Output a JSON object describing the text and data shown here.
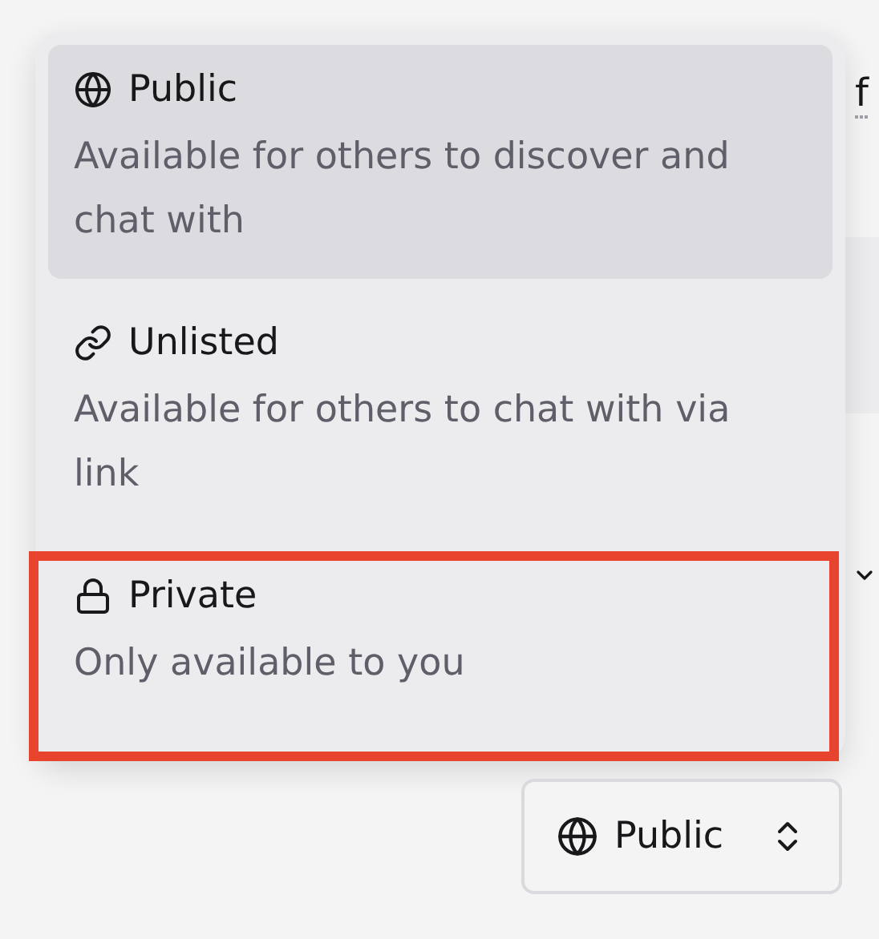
{
  "background": {
    "link_text": "f"
  },
  "visibility_menu": {
    "options": [
      {
        "kind": "globe",
        "title": "Public",
        "description": "Available for others to discover and chat with",
        "selected": true,
        "highlighted": false
      },
      {
        "kind": "link",
        "title": "Unlisted",
        "description": "Available for others to chat with via link",
        "selected": false,
        "highlighted": false
      },
      {
        "kind": "lock",
        "title": "Private",
        "description": "Only available to you",
        "selected": false,
        "highlighted": true
      }
    ]
  },
  "visibility_button": {
    "kind": "globe",
    "label": "Public"
  }
}
